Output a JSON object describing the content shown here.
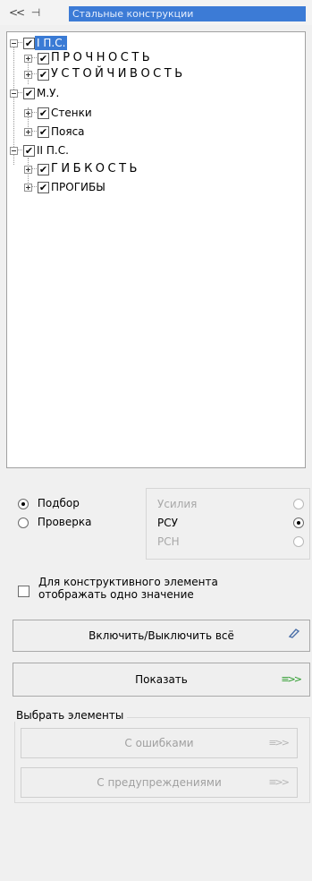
{
  "titlebar": {
    "back_label": "<<",
    "pin_label": "⊣",
    "title": "Стальные конструкции"
  },
  "tree": {
    "nodes": [
      {
        "label": "I  П.С.",
        "checked": true,
        "selected": true
      },
      {
        "label": "ПРОЧНОСТЬ",
        "checked": true
      },
      {
        "label": "УСТОЙЧИВОСТЬ",
        "checked": true
      },
      {
        "label": "М.У.",
        "checked": true
      },
      {
        "label": "Стенки",
        "checked": true
      },
      {
        "label": "Пояса",
        "checked": true
      },
      {
        "label": "II  П.С.",
        "checked": true
      },
      {
        "label": "ГИБКОСТЬ",
        "checked": true
      },
      {
        "label": "ПРОГИБЫ",
        "checked": true
      }
    ]
  },
  "mode": {
    "options": [
      {
        "label": "Подбор",
        "selected": true
      },
      {
        "label": "Проверка",
        "selected": false
      }
    ]
  },
  "source": {
    "options": [
      {
        "label": "Усилия",
        "selected": false,
        "enabled": false
      },
      {
        "label": "РСУ",
        "selected": true,
        "enabled": true
      },
      {
        "label": "РСН",
        "selected": false,
        "enabled": false
      }
    ]
  },
  "single_value": {
    "checked": false,
    "label_line1": "Для конструктивного элемента",
    "label_line2": "отображать одно значение"
  },
  "buttons": {
    "toggle_all": "Включить/Выключить всё",
    "show": "Показать",
    "show_icon": "≡>>"
  },
  "select_elements": {
    "legend": "Выбрать элементы",
    "with_errors": "С ошибками",
    "with_warnings": "С предупреждениями",
    "icon": "≡>>"
  }
}
